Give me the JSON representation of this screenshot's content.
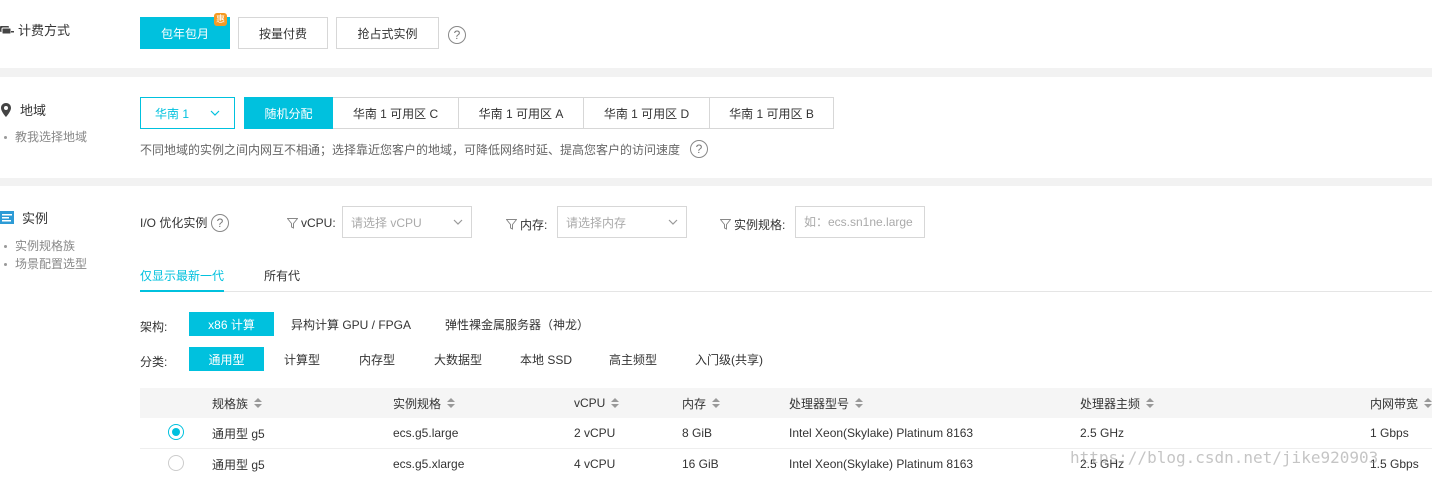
{
  "billing": {
    "title": "计费方式",
    "icon": "billing-icon",
    "options": [
      {
        "label": "包年包月",
        "active": true,
        "badge": "惠"
      },
      {
        "label": "按量付费",
        "active": false
      },
      {
        "label": "抢占式实例",
        "active": false
      }
    ],
    "help": "?"
  },
  "region": {
    "title": "地域",
    "icon": "map-pin-icon",
    "sub_items": [
      "教我选择地域"
    ],
    "selected_region": "华南 1",
    "zones": [
      {
        "label": "随机分配",
        "active": true
      },
      {
        "label": "华南 1 可用区 C",
        "active": false
      },
      {
        "label": "华南 1 可用区 A",
        "active": false
      },
      {
        "label": "华南 1 可用区 D",
        "active": false
      },
      {
        "label": "华南 1 可用区 B",
        "active": false
      }
    ],
    "hint": "不同地域的实例之间内网互不相通；选择靠近您客户的地域，可降低网络时延、提高您客户的访问速度",
    "help": "?"
  },
  "instance": {
    "title": "实例",
    "icon": "instance-icon",
    "sub_items": [
      "实例规格族",
      "场景配置选型"
    ],
    "io_optimized_label": "I/O 优化实例",
    "help": "?",
    "filters": {
      "vcpu_label": "vCPU:",
      "vcpu_placeholder": "请选择 vCPU",
      "memory_label": "内存:",
      "memory_placeholder": "请选择内存",
      "spec_label": "实例规格:",
      "spec_placeholder": "如：ecs.sn1ne.large"
    },
    "generation_tabs": [
      {
        "label": "仅显示最新一代",
        "active": true
      },
      {
        "label": "所有代",
        "active": false
      }
    ],
    "arch_label": "架构:",
    "arch_options": [
      {
        "label": "x86 计算",
        "active": true
      },
      {
        "label": "异构计算 GPU / FPGA",
        "active": false
      },
      {
        "label": "弹性裸金属服务器（神龙）",
        "active": false
      }
    ],
    "category_label": "分类:",
    "category_options": [
      {
        "label": "通用型",
        "active": true
      },
      {
        "label": "计算型",
        "active": false
      },
      {
        "label": "内存型",
        "active": false
      },
      {
        "label": "大数据型",
        "active": false
      },
      {
        "label": "本地 SSD",
        "active": false
      },
      {
        "label": "高主频型",
        "active": false
      },
      {
        "label": "入门级(共享)",
        "active": false
      }
    ],
    "table": {
      "columns": [
        "规格族",
        "实例规格",
        "vCPU",
        "内存",
        "处理器型号",
        "处理器主频",
        "内网带宽"
      ],
      "rows": [
        {
          "selected": true,
          "cells": [
            "通用型 g5",
            "ecs.g5.large",
            "2 vCPU",
            "8 GiB",
            "Intel Xeon(Skylake) Platinum 8163",
            "2.5 GHz",
            "1 Gbps"
          ]
        },
        {
          "selected": false,
          "cells": [
            "通用型 g5",
            "ecs.g5.xlarge",
            "4 vCPU",
            "16 GiB",
            "Intel Xeon(Skylake) Platinum 8163",
            "2.5 GHz",
            "1.5 Gbps"
          ]
        }
      ]
    }
  },
  "watermark": "https://blog.csdn.net/jike920903",
  "colors": {
    "accent": "#00c1de",
    "badge": "#f59a23",
    "separator": "#f2f2f2"
  }
}
